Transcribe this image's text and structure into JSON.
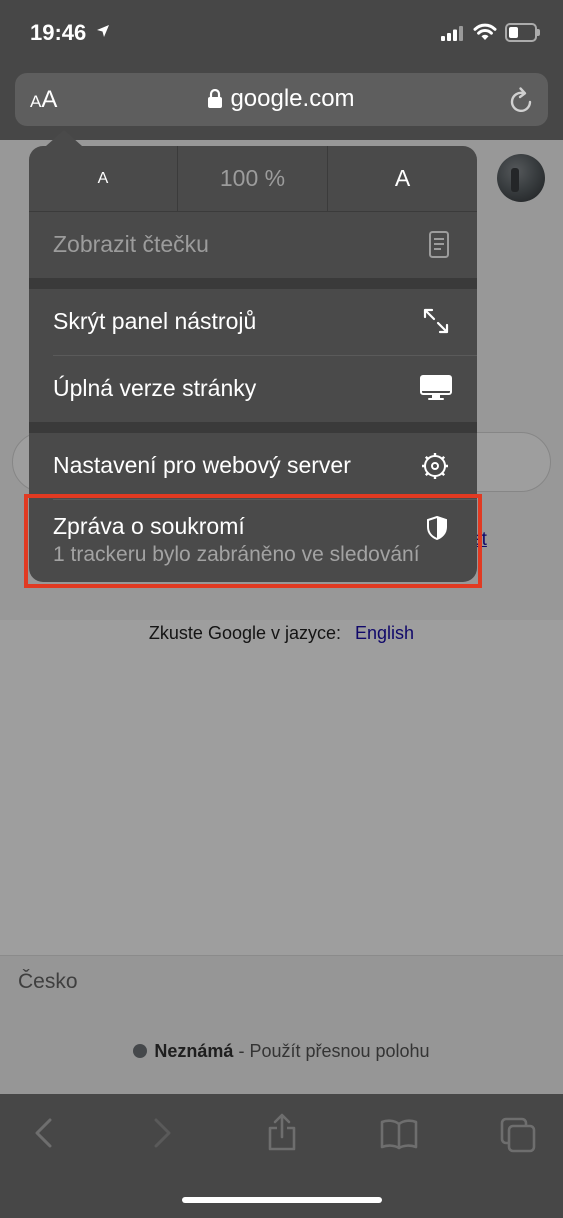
{
  "status_bar": {
    "time": "19:46"
  },
  "url_bar": {
    "text_size_small": "A",
    "text_size_big": "A",
    "domain": "google.com"
  },
  "menu": {
    "zoom_decrease": "A",
    "zoom_level": "100 %",
    "zoom_increase": "A",
    "items": [
      {
        "label": "Zobrazit čtečku",
        "icon": "reader-icon",
        "enabled": false
      },
      {
        "label": "Skrýt panel nástrojů",
        "icon": "expand-arrows-icon",
        "enabled": true
      },
      {
        "label": "Úplná verze stránky",
        "icon": "desktop-icon",
        "enabled": true
      },
      {
        "label": "Nastavení pro webový server",
        "icon": "gear-icon",
        "enabled": true
      },
      {
        "label": "Zpráva o soukromí",
        "icon": "shield-icon",
        "enabled": true
      }
    ],
    "privacy_subtitle": "1 trackeru bylo zabráněno ve sledování"
  },
  "page": {
    "partial_link": "et",
    "language_prompt": "Zkuste Google v jazyce:",
    "language_link": "English",
    "country": "Česko",
    "location_status": "Neznámá",
    "location_separator": " - ",
    "location_action": "Použít přesnou polohu"
  },
  "colors": {
    "highlight": "#e13a22",
    "link": "#1a0dab",
    "menu_background": "#4a4a4a"
  }
}
